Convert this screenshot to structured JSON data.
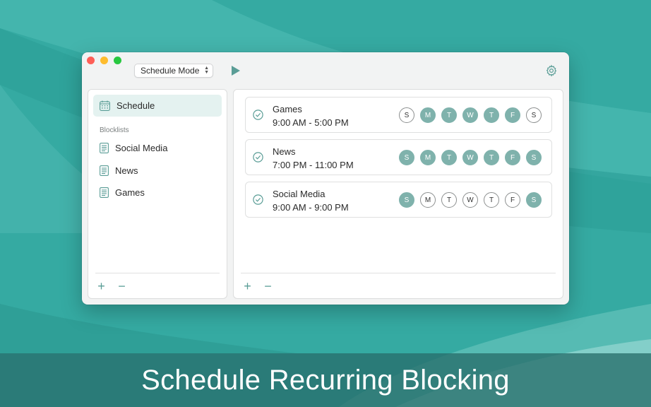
{
  "toolbar": {
    "mode": "Schedule Mode"
  },
  "sidebar": {
    "top_item": "Schedule",
    "section_label": "Blocklists",
    "blocklists": [
      "Social Media",
      "News",
      "Games"
    ]
  },
  "schedules": [
    {
      "name": "Games",
      "time": "9:00 AM - 5:00 PM",
      "days": [
        {
          "l": "S",
          "on": false
        },
        {
          "l": "M",
          "on": true
        },
        {
          "l": "T",
          "on": true
        },
        {
          "l": "W",
          "on": true
        },
        {
          "l": "T",
          "on": true
        },
        {
          "l": "F",
          "on": true
        },
        {
          "l": "S",
          "on": false
        }
      ]
    },
    {
      "name": "News",
      "time": "7:00 PM - 11:00 PM",
      "days": [
        {
          "l": "S",
          "on": true
        },
        {
          "l": "M",
          "on": true
        },
        {
          "l": "T",
          "on": true
        },
        {
          "l": "W",
          "on": true
        },
        {
          "l": "T",
          "on": true
        },
        {
          "l": "F",
          "on": true
        },
        {
          "l": "S",
          "on": true
        }
      ]
    },
    {
      "name": "Social Media",
      "time": "9:00 AM - 9:00 PM",
      "days": [
        {
          "l": "S",
          "on": true
        },
        {
          "l": "M",
          "on": false
        },
        {
          "l": "T",
          "on": false
        },
        {
          "l": "W",
          "on": false
        },
        {
          "l": "T",
          "on": false
        },
        {
          "l": "F",
          "on": false
        },
        {
          "l": "S",
          "on": true
        }
      ]
    }
  ],
  "controls": {
    "add": "+",
    "remove": "−"
  },
  "banner": "Schedule Recurring Blocking",
  "colors": {
    "accent": "#5a9d96",
    "day_on": "#7fb2ac",
    "bg": "#3aaea6"
  }
}
